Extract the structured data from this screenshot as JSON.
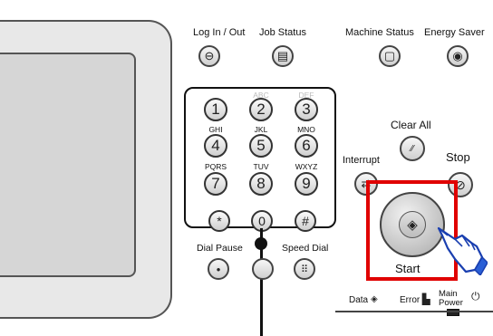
{
  "top_buttons": [
    {
      "label": "Log In / Out",
      "icon": "key-icon",
      "glyph": "⊖"
    },
    {
      "label": "Job Status",
      "icon": "job-status-icon",
      "glyph": "▤"
    },
    {
      "label": "Machine Status",
      "icon": "machine-status-icon",
      "glyph": "▢"
    },
    {
      "label": "Energy Saver",
      "icon": "energy-saver-icon",
      "glyph": "◉"
    }
  ],
  "keypad": {
    "keys": [
      {
        "digit": "1",
        "letters": ""
      },
      {
        "digit": "2",
        "letters": "ABC"
      },
      {
        "digit": "3",
        "letters": "DEF"
      },
      {
        "digit": "4",
        "letters": "GHI"
      },
      {
        "digit": "5",
        "letters": "JKL"
      },
      {
        "digit": "6",
        "letters": "MNO"
      },
      {
        "digit": "7",
        "letters": "PQRS"
      },
      {
        "digit": "8",
        "letters": "TUV"
      },
      {
        "digit": "9",
        "letters": "WXYZ"
      },
      {
        "digit": "*",
        "letters": ""
      },
      {
        "digit": "0",
        "letters": ""
      },
      {
        "digit": "#",
        "letters": ""
      }
    ]
  },
  "lower_buttons": {
    "dial_pause": {
      "label": "Dial Pause",
      "glyph": "•"
    },
    "unlabeled": {
      "glyph": ""
    },
    "speed_dial": {
      "label": "Speed Dial",
      "glyph": "⠿"
    }
  },
  "controls": {
    "clear_all": {
      "label": "Clear All",
      "glyph": "⁄⁄"
    },
    "interrupt": {
      "label": "Interrupt",
      "glyph": "⇄"
    },
    "stop": {
      "label": "Stop",
      "glyph": "⊘"
    },
    "start": {
      "label": "Start",
      "glyph": "◈"
    }
  },
  "indicators": {
    "data": "Data",
    "error": "Error",
    "main_power": "Main Power"
  },
  "colors": {
    "highlight": "#e00000",
    "outline": "#111111",
    "hand": "#2a5fd6"
  }
}
